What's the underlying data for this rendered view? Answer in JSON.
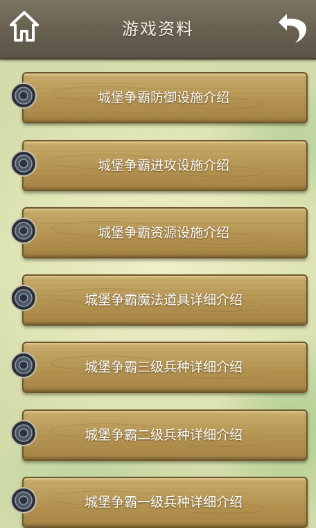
{
  "header": {
    "title": "游戏资料"
  },
  "menu": {
    "items": [
      {
        "label": "城堡争霸防御设施介绍"
      },
      {
        "label": "城堡争霸进攻设施介绍"
      },
      {
        "label": "城堡争霸资源设施介绍"
      },
      {
        "label": "城堡争霸魔法道具详细介绍"
      },
      {
        "label": "城堡争霸三级兵种详细介绍"
      },
      {
        "label": "城堡争霸二级兵种详细介绍"
      },
      {
        "label": "城堡争霸一级兵种详细介绍"
      }
    ]
  },
  "icons": {
    "home": "home-icon",
    "back": "back-arrow-icon",
    "item_marker": "shield-knob-icon"
  },
  "colors": {
    "topbar": "#6a6354",
    "plank": "#bb9c5a",
    "label": "#ffffff"
  }
}
